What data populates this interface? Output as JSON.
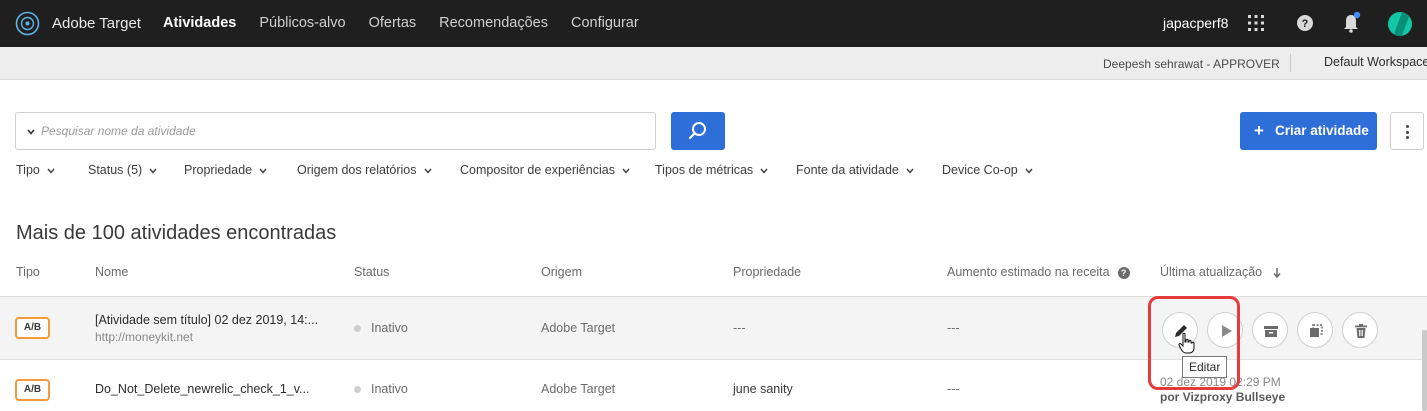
{
  "app": {
    "brand": "Adobe Target",
    "nav": [
      "Atividades",
      "Públicos-alvo",
      "Ofertas",
      "Recomendações",
      "Configurar"
    ],
    "active_nav": "Atividades",
    "user": "japacperf8"
  },
  "subbar": {
    "role": "Deepesh sehrawat - APPROVER",
    "workspace": "Default Workspace"
  },
  "search": {
    "placeholder": "Pesquisar nome da atividade"
  },
  "create_button": {
    "plus": "+",
    "label": "Criar atividade"
  },
  "filters": [
    "Tipo",
    "Status (5)",
    "Propriedade",
    "Origem dos relatórios",
    "Compositor de experiências",
    "Tipos de métricas",
    "Fonte da atividade",
    "Device Co-op"
  ],
  "results_title": "Mais de 100 atividades encontradas",
  "table": {
    "headers": {
      "tipo": "Tipo",
      "nome": "Nome",
      "status": "Status",
      "origem": "Origem",
      "propriedade": "Propriedade",
      "aumento": "Aumento estimado na receita",
      "atualizacao": "Última atualização"
    },
    "rows": [
      {
        "type": "A/B",
        "name": "[Atividade sem título] 02 dez 2019, 14:...",
        "url": "http://moneykit.net",
        "status": "Inativo",
        "origin": "Adobe Target",
        "property": "---",
        "lift": "---"
      },
      {
        "type": "A/B",
        "name": "Do_Not_Delete_newrelic_check_1_v...",
        "status": "Inativo",
        "origin": "Adobe Target",
        "property": "june sanity",
        "lift": "---",
        "updated": "02 dez 2019 02:29 PM",
        "updated_by": "por Vizproxy Bullseye"
      }
    ]
  },
  "tooltip": "Editar",
  "colors": {
    "topbar": "#1f1f1f",
    "primary": "#2d6ed8",
    "badge_border": "#f29a3c",
    "highlight": "#e53b3b",
    "avatar": "#12c6a6"
  },
  "icons": [
    "adobe-target-logo-icon",
    "search-icon",
    "apps-grid-icon",
    "help-icon",
    "bell-icon",
    "edit-icon",
    "play-icon",
    "archive-icon",
    "copy-icon",
    "trash-icon",
    "more-vertical-icon"
  ]
}
